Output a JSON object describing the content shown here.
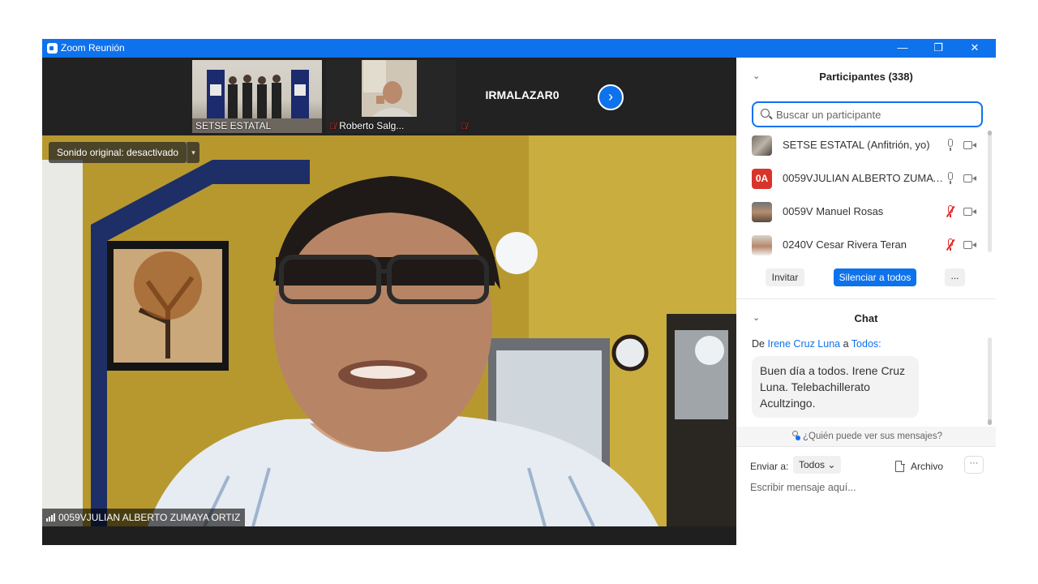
{
  "window": {
    "title": "Zoom Reunión",
    "minimize": "—",
    "restore": "❐",
    "close": "✕"
  },
  "gallery": {
    "tiles": [
      {
        "name": "SETSE ESTATAL"
      },
      {
        "name": "Roberto Salg..."
      },
      {
        "name": "IRMALAZAR0"
      }
    ],
    "next": "›"
  },
  "main_video": {
    "sound_label": "Sonido original: desactivado",
    "sound_arrow": "▾",
    "speaker_name": "0059VJULIAN ALBERTO ZUMAYA ORTIZ"
  },
  "participants": {
    "collapse": "⌄",
    "title": "Participantes (338)",
    "search_placeholder": "Buscar un participante",
    "list": [
      {
        "name": "SETSE ESTATAL (Anfitrión, yo)",
        "initials": "",
        "mic": "on"
      },
      {
        "name": "0059VJULIAN ALBERTO ZUMAYA...",
        "initials": "0A",
        "mic": "on"
      },
      {
        "name": "0059V Manuel Rosas",
        "initials": "",
        "mic": "muted"
      },
      {
        "name": "0240V Cesar Rivera Teran",
        "initials": "",
        "mic": "muted"
      }
    ],
    "invite_label": "Invitar",
    "mute_all_label": "Silenciar a todos",
    "more_label": "..."
  },
  "chat": {
    "collapse": "⌄",
    "title": "Chat",
    "from_prefix": "De",
    "from_sender": "Irene Cruz Luna",
    "from_mid": "a",
    "from_target": "Todos",
    "from_suffix": ":",
    "message": "Buen día a todos. Irene Cruz Luna. Telebachillerato Acultzingo.",
    "who_can_see": "¿Quién puede ver sus mensajes?",
    "send_to_label": "Enviar a:",
    "send_to_value": "Todos ⌄",
    "file_label": "Archivo",
    "more_label": "···",
    "input_placeholder": "Escribir mensaje aquí..."
  },
  "colors": {
    "accent": "#0e72ed",
    "muted_red": "#e02828",
    "initials_badge": "#d9342b"
  }
}
